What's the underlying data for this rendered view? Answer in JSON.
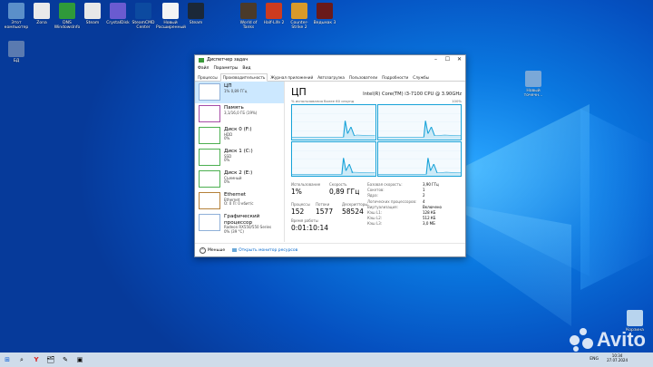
{
  "desktop": {
    "icons": [
      {
        "label": "Этот компьютер",
        "color": "#5b8fc9"
      },
      {
        "label": "Zona",
        "color": "#eaeaea"
      },
      {
        "label": "DNS WindowsInfo",
        "color": "#2f9a3a"
      },
      {
        "label": "Steam",
        "color": "#e8e8e8"
      },
      {
        "label": "CrystalDisk",
        "color": "#6a5bd0"
      },
      {
        "label": "SteamCMD Center",
        "color": "#0c4aa0"
      },
      {
        "label": "Новый Расширенный",
        "color": "#f4f4f4"
      },
      {
        "label": "Steam",
        "color": "#1b2838"
      },
      {
        "label": "World of Tanks",
        "color": "#4a3a2a"
      },
      {
        "label": "Half-Life 2",
        "color": "#cc3b1f"
      },
      {
        "label": "Counter-Strike 2",
        "color": "#d89a2a"
      },
      {
        "label": "Ведьмак 3",
        "color": "#6a1a1a"
      },
      {
        "label": "БД",
        "color": "#5a7ab0"
      },
      {
        "label": "Новый точечн...",
        "color": "#7aa8d8"
      },
      {
        "label": "Корзина",
        "color": "#b8d4ee"
      }
    ]
  },
  "window": {
    "title": "Диспетчер задач",
    "controls": [
      "–",
      "☐",
      "✕"
    ],
    "menu": [
      "Файл",
      "Параметры",
      "Вид"
    ],
    "tabs": [
      "Процессы",
      "Производительность",
      "Журнал приложений",
      "Автозагрузка",
      "Пользователи",
      "Подробности",
      "Службы"
    ],
    "active_tab": "Производительность",
    "sidebar": [
      {
        "title": "ЦП",
        "sub1": "1% 0,89 ГГц",
        "sub2": ""
      },
      {
        "title": "Память",
        "sub1": "3,1/16,0 ГБ (19%)",
        "sub2": ""
      },
      {
        "title": "Диск 0 (F:)",
        "sub1": "HDD",
        "sub2": "0%"
      },
      {
        "title": "Диск 1 (C:)",
        "sub1": "SSD",
        "sub2": "0%"
      },
      {
        "title": "Диск 2 (E:)",
        "sub1": "Съемный",
        "sub2": "0%"
      },
      {
        "title": "Ethernet",
        "sub1": "Ethernet",
        "sub2": "О: 0 П: 0 кбит/с"
      },
      {
        "title": "Графический процессор",
        "sub1": "Radeon RX550/550 Series",
        "sub2": "0% (39 °C)"
      }
    ],
    "main": {
      "heading": "ЦП",
      "cpu_name": "Intel(R) Core(TM) i3-7100 CPU @ 3.90GHz",
      "graph_caption": "% использования более 60 секунд",
      "graph_max": "100%",
      "stats": [
        {
          "label": "Использование",
          "value": "1%"
        },
        {
          "label": "Скорость",
          "value": "0,89 ГГц"
        },
        {
          "label": "Процессы",
          "value": "152"
        },
        {
          "label": "Потоки",
          "value": "1577"
        },
        {
          "label": "Дескрипторы",
          "value": "58524"
        },
        {
          "label": "Время работы",
          "value": "0:01:10:14"
        }
      ],
      "details": [
        {
          "k": "Базовая скорость:",
          "v": "3,90 ГГц"
        },
        {
          "k": "Сокетов:",
          "v": "1"
        },
        {
          "k": "Ядра:",
          "v": "2"
        },
        {
          "k": "Логических процессоров:",
          "v": "4"
        },
        {
          "k": "Виртуализация:",
          "v": "Включено"
        },
        {
          "k": "Кэш L1:",
          "v": "128 КБ"
        },
        {
          "k": "Кэш L2:",
          "v": "512 КБ"
        },
        {
          "k": "Кэш L3:",
          "v": "3,0 МБ"
        }
      ]
    },
    "footer": {
      "less": "Меньше",
      "monitor": "Открыть монитор ресурсов"
    }
  },
  "taskbar": {
    "apps": [
      "⊞",
      "⌕",
      "Y",
      "🗂",
      "✎",
      "▣"
    ],
    "lang": "ENG",
    "time": "10:34",
    "date": "27.07.2024"
  },
  "watermark": "Avito",
  "colors": {
    "accent": "#17a2d8",
    "selected": "#cce8ff"
  }
}
